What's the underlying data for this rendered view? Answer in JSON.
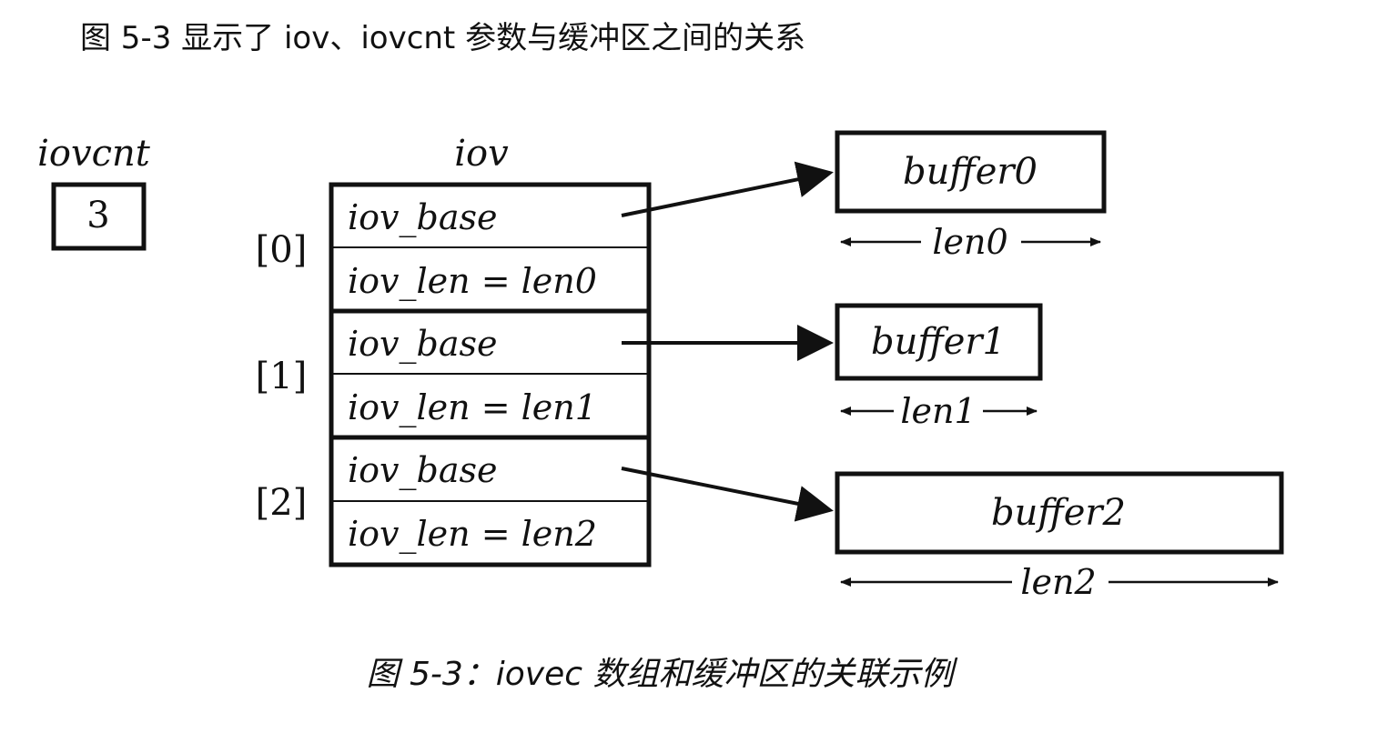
{
  "intro_text": "图 5-3 显示了 iov、iovcnt 参数与缓冲区之间的关系",
  "caption": "图 5-3：iovec 数组和缓冲区的关联示例",
  "iovcnt": {
    "label": "iovcnt",
    "value": "3"
  },
  "iov": {
    "label": "iov",
    "entries": [
      {
        "index_label": "[0]",
        "base_label": "iov_base",
        "len_label": "iov_len = len0"
      },
      {
        "index_label": "[1]",
        "base_label": "iov_base",
        "len_label": "iov_len = len1"
      },
      {
        "index_label": "[2]",
        "base_label": "iov_base",
        "len_label": "iov_len = len2"
      }
    ]
  },
  "buffers": [
    {
      "name": "buffer0",
      "len_label": "len0"
    },
    {
      "name": "buffer1",
      "len_label": "len1"
    },
    {
      "name": "buffer2",
      "len_label": "len2"
    }
  ],
  "colors": {
    "ink": "#111111"
  }
}
